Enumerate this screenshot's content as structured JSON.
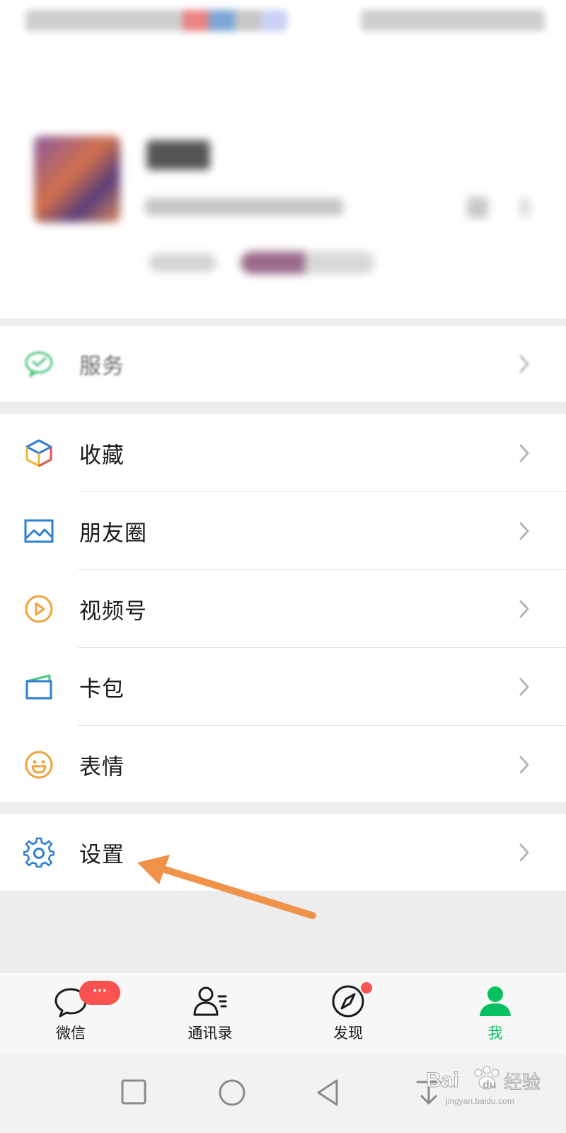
{
  "menu": {
    "service": {
      "label": "服务",
      "icon": "wechat-pay-icon"
    },
    "group_main": [
      {
        "id": "favorites",
        "label": "收藏",
        "icon": "cube-icon"
      },
      {
        "id": "moments",
        "label": "朋友圈",
        "icon": "picture-icon"
      },
      {
        "id": "channels",
        "label": "视频号",
        "icon": "play-circle-icon"
      },
      {
        "id": "cards",
        "label": "卡包",
        "icon": "card-wallet-icon"
      },
      {
        "id": "stickers",
        "label": "表情",
        "icon": "smile-icon"
      }
    ],
    "settings": {
      "label": "设置",
      "icon": "gear-icon"
    }
  },
  "tabbar": {
    "tabs": [
      {
        "id": "chats",
        "label": "微信",
        "icon": "chat-bubble-icon",
        "badge": "···"
      },
      {
        "id": "contacts",
        "label": "通讯录",
        "icon": "contacts-icon"
      },
      {
        "id": "discover",
        "label": "发现",
        "icon": "compass-icon",
        "dot": true
      },
      {
        "id": "me",
        "label": "我",
        "icon": "person-icon",
        "active": true
      }
    ]
  },
  "watermark": {
    "text_latin": "Bai",
    "text_latin2": "du",
    "text_cn": "经验",
    "url": "jingyan.baidu.com"
  },
  "colors": {
    "accent": "#07c160",
    "badge": "#fa5151",
    "arrow": "#f0924a",
    "icon_blue": "#2f7fd1",
    "icon_orange": "#f0a23b"
  }
}
